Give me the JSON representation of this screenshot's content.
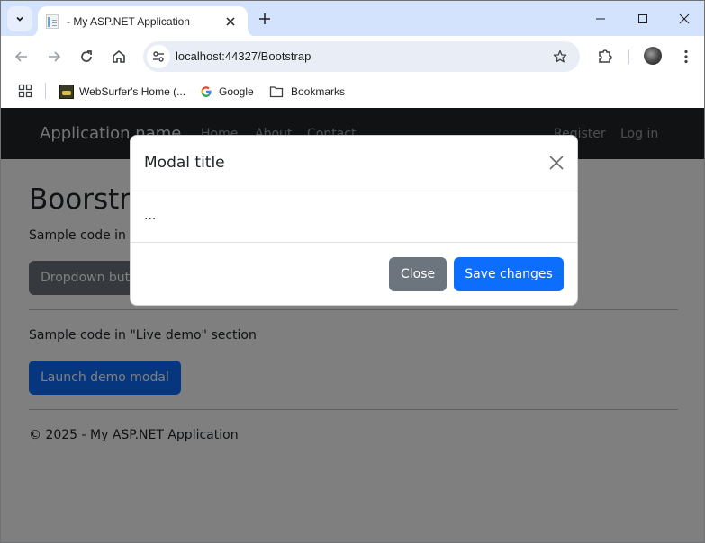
{
  "browser": {
    "tab": {
      "title": "- My ASP.NET Application",
      "favicon": "document-icon"
    },
    "window_controls": [
      "minimize",
      "maximize",
      "close"
    ],
    "address_bar": {
      "url": "localhost:44327/Bootstrap"
    },
    "nav_buttons": [
      "back",
      "forward",
      "reload",
      "home"
    ],
    "bookmarks": [
      {
        "label": "WebSurfer's Home (...",
        "icon": "websurfer-favicon"
      },
      {
        "label": "Google",
        "icon": "google-icon"
      },
      {
        "label": "Bookmarks",
        "icon": "folder-icon"
      }
    ]
  },
  "navbar": {
    "brand": "Application name",
    "links": [
      "Home",
      "About",
      "Contact"
    ],
    "right_links": [
      "Register",
      "Log in"
    ]
  },
  "content": {
    "title": "Boorstrap",
    "section1_text": "Sample code in \"Dropdowns\" section",
    "dropdown_button": "Dropdown button",
    "section2_text": "Sample code in \"Live demo\" section",
    "launch_button": "Launch demo modal",
    "footer": "© 2025 - My ASP.NET Application"
  },
  "modal": {
    "title": "Modal title",
    "body": "...",
    "close_label": "Close",
    "save_label": "Save changes"
  },
  "colors": {
    "primary": "#0d6efd",
    "secondary": "#6c757d",
    "navbar": "#212529",
    "tabstrip": "#d3e3fd"
  }
}
